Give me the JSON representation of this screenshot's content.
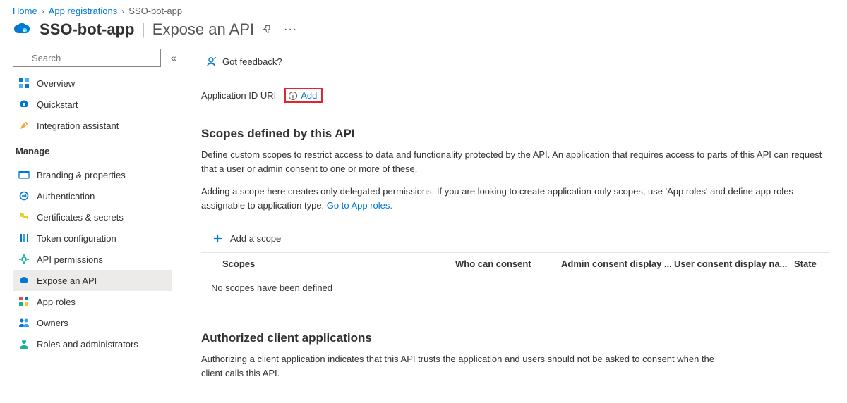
{
  "breadcrumb": {
    "home": "Home",
    "registrations": "App registrations",
    "current": "SSO-bot-app"
  },
  "title": {
    "app_name": "SSO-bot-app",
    "page": "Expose an API"
  },
  "sidebar": {
    "search_placeholder": "Search",
    "items": {
      "overview": "Overview",
      "quickstart": "Quickstart",
      "integration": "Integration assistant"
    },
    "manage_header": "Manage",
    "manage": {
      "branding": "Branding & properties",
      "auth": "Authentication",
      "certs": "Certificates & secrets",
      "token": "Token configuration",
      "api_perm": "API permissions",
      "expose": "Expose an API",
      "app_roles": "App roles",
      "owners": "Owners",
      "roles_admin": "Roles and administrators"
    }
  },
  "cmdbar": {
    "feedback": "Got feedback?"
  },
  "app_id_uri": {
    "label": "Application ID URI",
    "add": "Add"
  },
  "scopes": {
    "heading": "Scopes defined by this API",
    "desc1": "Define custom scopes to restrict access to data and functionality protected by the API. An application that requires access to parts of this API can request that a user or admin consent to one or more of these.",
    "desc2a": "Adding a scope here creates only delegated permissions. If you are looking to create application-only scopes, use 'App roles' and define app roles assignable to application type. ",
    "desc2_link": "Go to App roles.",
    "add_scope": "Add a scope",
    "cols": {
      "scopes": "Scopes",
      "who": "Who can consent",
      "admin": "Admin consent display ...",
      "user": "User consent display na...",
      "state": "State"
    },
    "empty": "No scopes have been defined"
  },
  "authorized": {
    "heading": "Authorized client applications",
    "desc": "Authorizing a client application indicates that this API trusts the application and users should not be asked to consent when the client calls this API."
  }
}
